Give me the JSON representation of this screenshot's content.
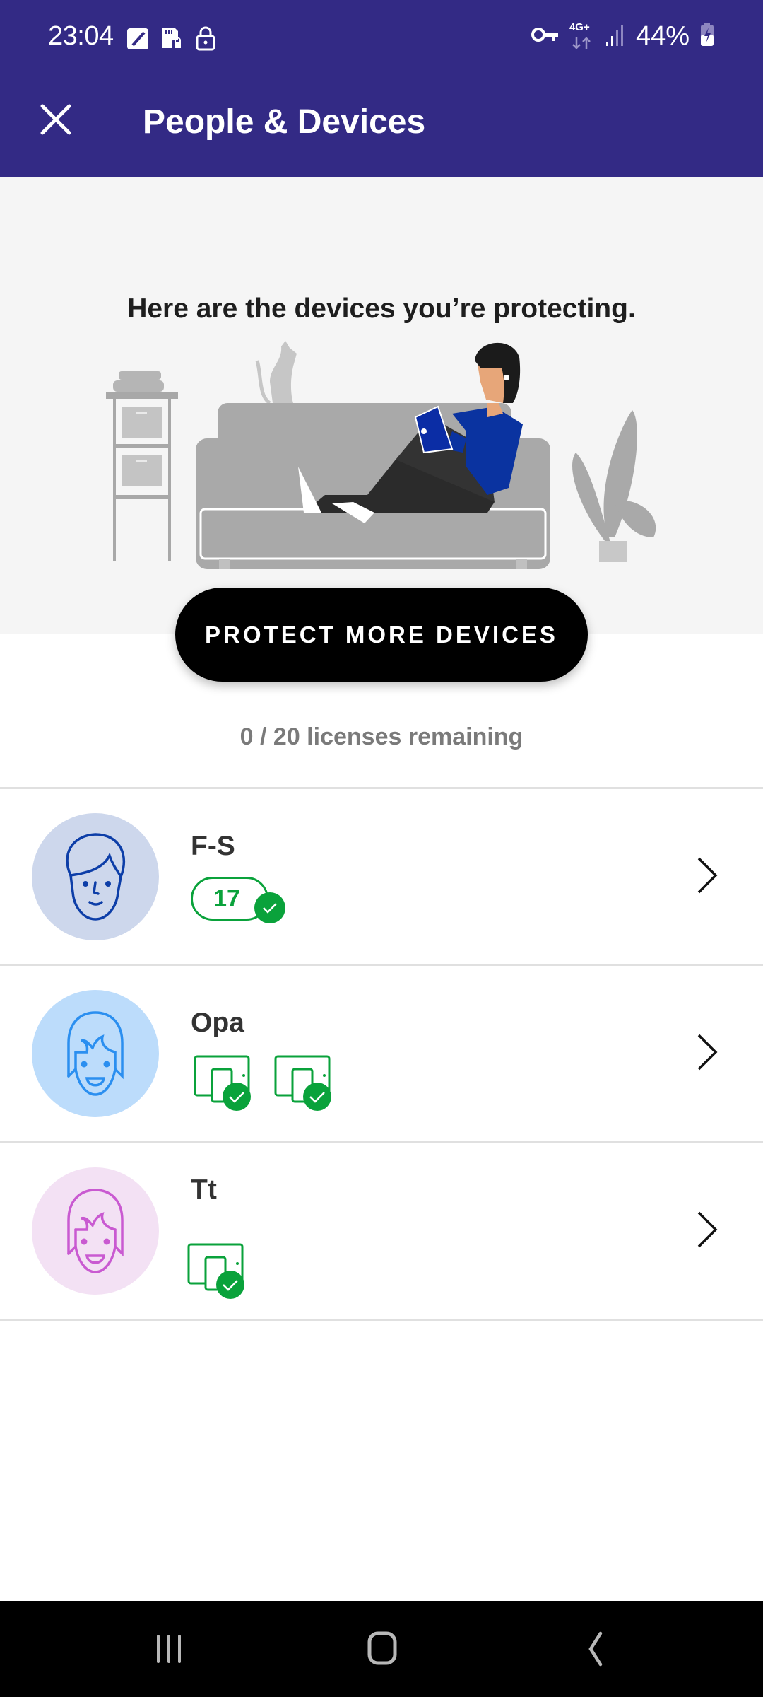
{
  "status_bar": {
    "time": "23:04",
    "left_icons": [
      "edit-note-icon",
      "sd-card-lock-icon",
      "lock-icon"
    ],
    "right_icons": [
      "vpn-key-icon",
      "network-4g-plus-icon",
      "signal-icon",
      "battery-charging-icon"
    ],
    "network_label": "4G+",
    "battery": "44%"
  },
  "header": {
    "title": "People & Devices",
    "close_icon": "close-icon",
    "background_color": "#332a85"
  },
  "hero": {
    "heading": "Here are the devices you’re protecting.",
    "illustration": "person-on-sofa-with-tablet",
    "cta_label": "PROTECT MORE DEVICES"
  },
  "licenses": {
    "text": "0 / 20 licenses remaining",
    "used": 0,
    "total": 20
  },
  "people": [
    {
      "name": "F-S",
      "avatar": "adult-face-icon",
      "avatar_color": "#0d3ea8",
      "avatar_bg": "#cdd7ec",
      "device_count": "17",
      "devices": [],
      "status": "protected"
    },
    {
      "name": "Opa",
      "avatar": "child-face-icon",
      "avatar_color": "#2b8ff0",
      "avatar_bg": "#bcdcfb",
      "device_count": null,
      "devices": [
        "protected-device",
        "protected-device"
      ],
      "status": "protected"
    },
    {
      "name": "Tt",
      "avatar": "child-face-icon",
      "avatar_color": "#c95ad1",
      "avatar_bg": "#f3e1f4",
      "device_count": null,
      "devices": [
        "protected-device"
      ],
      "status": "protected"
    }
  ],
  "colors": {
    "success": "#0aa23b",
    "text_primary": "#333333",
    "text_secondary": "#7a7a7a"
  },
  "nav_bar": {
    "buttons": [
      "recents-icon",
      "home-icon",
      "back-icon"
    ]
  }
}
